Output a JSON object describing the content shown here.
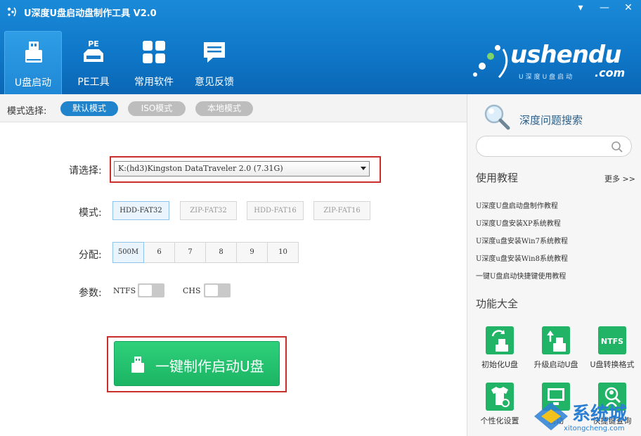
{
  "window": {
    "title": "U深度U盘启动盘制作工具 V2.0",
    "min_arrow": "▾",
    "min": "—",
    "close": "✕"
  },
  "nav": {
    "items": [
      {
        "label": "U盘启动",
        "icon": "usb-drive-icon",
        "active": true
      },
      {
        "label": "PE工具",
        "icon": "pe-tool-icon",
        "badge": "PE"
      },
      {
        "label": "常用软件",
        "icon": "apps-grid-icon"
      },
      {
        "label": "意见反馈",
        "icon": "chat-bubble-icon"
      }
    ]
  },
  "brand": {
    "name": "ushendu",
    "sub": "U深度U盘启动",
    "domain": ".com"
  },
  "modebar": {
    "label": "模式选择:",
    "modes": [
      "默认模式",
      "ISO模式",
      "本地模式"
    ],
    "selected": "默认模式"
  },
  "form": {
    "select_label": "请选择:",
    "select_value": "K:(hd3)Kingston DataTraveler 2.0 (7.31G)",
    "mode_label": "模式:",
    "formats": [
      "HDD-FAT32",
      "ZIP-FAT32",
      "HDD-FAT16",
      "ZIP-FAT16"
    ],
    "format_selected": "HDD-FAT32",
    "alloc_label": "分配:",
    "allocs": [
      "500M",
      "6",
      "7",
      "8",
      "9",
      "10"
    ],
    "alloc_selected": "500M",
    "param_label": "参数:",
    "ntfs": "NTFS",
    "chs": "CHS",
    "make_button": "一键制作启动U盘"
  },
  "right": {
    "search_title": "深度问题搜索",
    "search_placeholder": "",
    "tutorials_title": "使用教程",
    "more": "更多 >>",
    "tutorials": [
      "U深度U盘启动盘制作教程",
      "U深度U盘安装XP系统教程",
      "U深度u盘安装Win7系统教程",
      "U深度u盘安装Win8系统教程",
      "一键U盘启动快捷键使用教程"
    ],
    "features_title": "功能大全",
    "tools": [
      {
        "label": "初始化U盘",
        "icon": "init-usb-icon"
      },
      {
        "label": "升级启动U盘",
        "icon": "upgrade-usb-icon"
      },
      {
        "label": "U盘转换格式",
        "icon": "ntfs-convert-icon",
        "badge": "NTFS"
      },
      {
        "label": "个性化设置",
        "icon": "tshirt-settings-icon"
      },
      {
        "label": "启动",
        "icon": "monitor-icon"
      },
      {
        "label": "快捷键查询",
        "icon": "search-user-icon"
      }
    ]
  },
  "watermark": {
    "text": "系统城",
    "url": "xitongcheng.com"
  },
  "colors": {
    "header_blue": "#0f76c7",
    "accent_blue": "#1f84cc",
    "green": "#21b466",
    "highlight_red": "#c9302c"
  }
}
